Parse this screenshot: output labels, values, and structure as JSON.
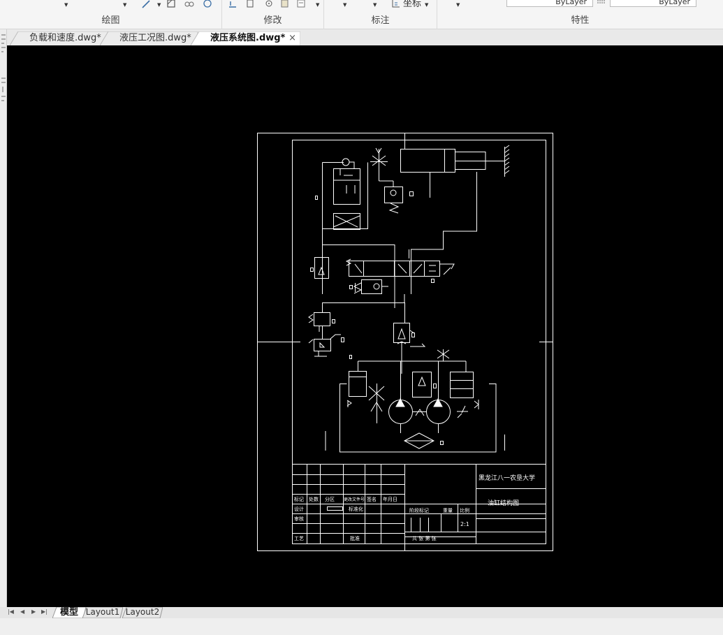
{
  "ribbon": {
    "groups": [
      {
        "label": "绘图"
      },
      {
        "label": "修改"
      },
      {
        "label": "标注"
      },
      {
        "label": "特性"
      }
    ],
    "annotation_tool": "坐标",
    "layer_value": "ByLayer",
    "linetype_value": "ByLayer"
  },
  "doc_tabs": [
    {
      "label": "负载和速度.dwg*"
    },
    {
      "label": "液压工况图.dwg*"
    },
    {
      "label": "液压系统图.dwg*"
    }
  ],
  "active_doc_close": "×",
  "title_block": {
    "school": "黑龙江八一农垦大学",
    "drawing_name": "油缸结构图",
    "scale": "2:1",
    "headers": {
      "mark": "标记",
      "count": "处数",
      "zone": "分区",
      "change_doc": "更改文件号",
      "sign": "签名",
      "date": "年月日",
      "design": "设计",
      "standardize": "标准化",
      "check": "审核",
      "process": "工艺",
      "approve": "批准",
      "stage_mark": "阶段标记",
      "weight": "重量",
      "ratio": "比例",
      "sheets": "共  张  第  张"
    }
  },
  "layout_tabs": [
    {
      "label": "模型"
    },
    {
      "label": "Layout1"
    },
    {
      "label": "Layout2"
    }
  ],
  "nav_glyphs": [
    "|◀",
    "◀",
    "▶",
    "▶|"
  ],
  "colors": {
    "canvas": "#000000",
    "drawing_line": "#ffffff",
    "ribbon_bg": "#f5f5f5",
    "icon_blue": "#3a6ea5"
  }
}
